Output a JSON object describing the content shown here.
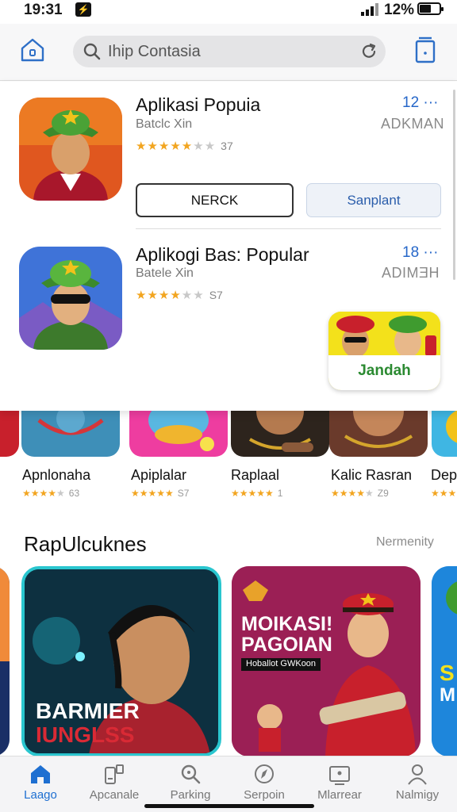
{
  "status_bar": {
    "time": "19:31",
    "battery": "12%"
  },
  "search": {
    "text": "Ihip Contasia"
  },
  "featured": [
    {
      "name": "Aplikasi Popuia",
      "subtitle": "Batclc Xin",
      "rating": 4.5,
      "count": "37",
      "rank": "12 ···",
      "developer": "ADKMAN"
    },
    {
      "name": "Aplikogi Bas: Popular",
      "subtitle": "Batele Xin",
      "rating": 4,
      "count": "S7",
      "rank": "18 ···",
      "developer": "ADIMƎH"
    }
  ],
  "buttons": {
    "outline": "NERCK",
    "filled": "Sanplant"
  },
  "promo_tile": {
    "label": "Jandah"
  },
  "mini_apps": [
    {
      "name": "Apnlonaha",
      "rating": 4.5,
      "count": "63"
    },
    {
      "name": "Apiplalar",
      "rating": 5,
      "count": "S7"
    },
    {
      "name": "Raplaal",
      "rating": 5,
      "count": "1"
    },
    {
      "name": "Kalic Rasran",
      "rating": 4,
      "count": "Z9"
    },
    {
      "name": "Dep",
      "rating": 3,
      "count": ""
    }
  ],
  "section": {
    "title": "RapUlcuknes",
    "more": "Nermenity"
  },
  "banners": [
    {
      "line1": "BARMIER",
      "line2": "IUNGLSS"
    },
    {
      "line1": "MOIKASI!",
      "line2": "PAGOIAN",
      "tag": "Hoballot GWKoon"
    },
    {
      "line1": "S",
      "line2": "M"
    }
  ],
  "bottom_nav": [
    {
      "label": "Laago",
      "icon": "home-icon",
      "active": true
    },
    {
      "label": "Apcanale",
      "icon": "apps-icon",
      "active": false
    },
    {
      "label": "Parking",
      "icon": "search-icon",
      "active": false
    },
    {
      "label": "Serpoin",
      "icon": "compass-icon",
      "active": false
    },
    {
      "label": "Mlarrear",
      "icon": "store-icon",
      "active": false
    },
    {
      "label": "Nalmigy",
      "icon": "person-icon",
      "active": false
    }
  ],
  "colors": {
    "accent": "#1e6fd1",
    "star": "#f2a520"
  }
}
